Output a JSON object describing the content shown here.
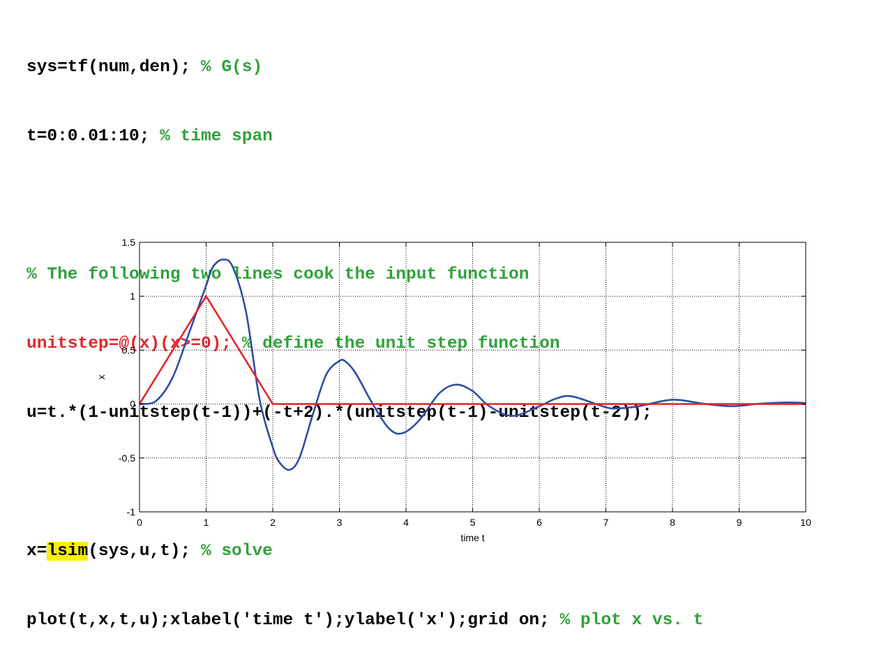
{
  "code": {
    "line1": {
      "stmt": "sys=tf(num,den); ",
      "comment": "% G(s)"
    },
    "line2": {
      "stmt": "t=0:0.01:10; ",
      "comment": "% time span"
    },
    "line3": {
      "comment": "% The following two lines cook the input function"
    },
    "line4": {
      "stmt": "unitstep=@(x)(x>=0);",
      "comment": " % define the unit step function"
    },
    "line5": {
      "stmt": "u=t.*(1-unitstep(t-1))+(-t+2).*(unitstep(t-1)-unitstep(t-2));"
    },
    "line6": {
      "prefix": "x=",
      "highlight": "lsim",
      "rest": "(sys,u,t); ",
      "comment": "% solve"
    },
    "line7": {
      "stmt": "plot(t,x,t,u);xlabel('time t');ylabel('x');grid on; ",
      "comment": "% plot x vs. t"
    }
  },
  "colors": {
    "comment": "#2ea33a",
    "red_code": "#e3262c",
    "highlight": "#f7f100",
    "series_x": "#2b4fa3",
    "series_u": "#e3262c"
  },
  "chart_data": {
    "type": "line",
    "xlabel": "time t",
    "ylabel": "x",
    "xlim": [
      0,
      10
    ],
    "ylim": [
      -1,
      1.5
    ],
    "xticks": [
      0,
      1,
      2,
      3,
      4,
      5,
      6,
      7,
      8,
      9,
      10
    ],
    "yticks": [
      -1,
      -0.5,
      0,
      0.5,
      1,
      1.5
    ],
    "xtick_labels": [
      "0",
      "1",
      "2",
      "3",
      "4",
      "5",
      "6",
      "7",
      "8",
      "9",
      "10"
    ],
    "ytick_labels": [
      "-1",
      "-0.5",
      "0",
      "0.5",
      "1",
      "1.5"
    ],
    "grid": true,
    "series": [
      {
        "color": "#2b4fa3",
        "x": [
          0,
          0.25,
          0.5,
          0.75,
          1.0,
          1.1,
          1.25,
          1.4,
          1.6,
          1.8,
          2.0,
          2.1,
          2.25,
          2.4,
          2.6,
          2.8,
          3.0,
          3.1,
          3.25,
          3.5,
          3.75,
          3.95,
          4.2,
          4.5,
          4.75,
          5.0,
          5.25,
          5.6,
          6.0,
          6.25,
          6.5,
          7.0,
          7.2,
          7.5,
          8.0,
          8.5,
          8.9,
          9.25,
          9.5,
          9.75,
          10.0
        ],
        "values": [
          0,
          0.03,
          0.25,
          0.67,
          1.1,
          1.27,
          1.34,
          1.27,
          0.85,
          0.05,
          -0.4,
          -0.54,
          -0.61,
          -0.5,
          -0.1,
          0.27,
          0.4,
          0.39,
          0.28,
          0.0,
          -0.23,
          -0.27,
          -0.15,
          0.1,
          0.18,
          0.12,
          -0.02,
          -0.11,
          -0.02,
          0.05,
          0.07,
          -0.03,
          -0.04,
          -0.02,
          0.04,
          0.0,
          -0.02,
          0.0,
          0.01,
          0.015,
          0.01
        ]
      },
      {
        "color": "#e3262c",
        "x": [
          0,
          1,
          2,
          10
        ],
        "values": [
          0,
          1,
          0,
          0
        ]
      }
    ]
  }
}
